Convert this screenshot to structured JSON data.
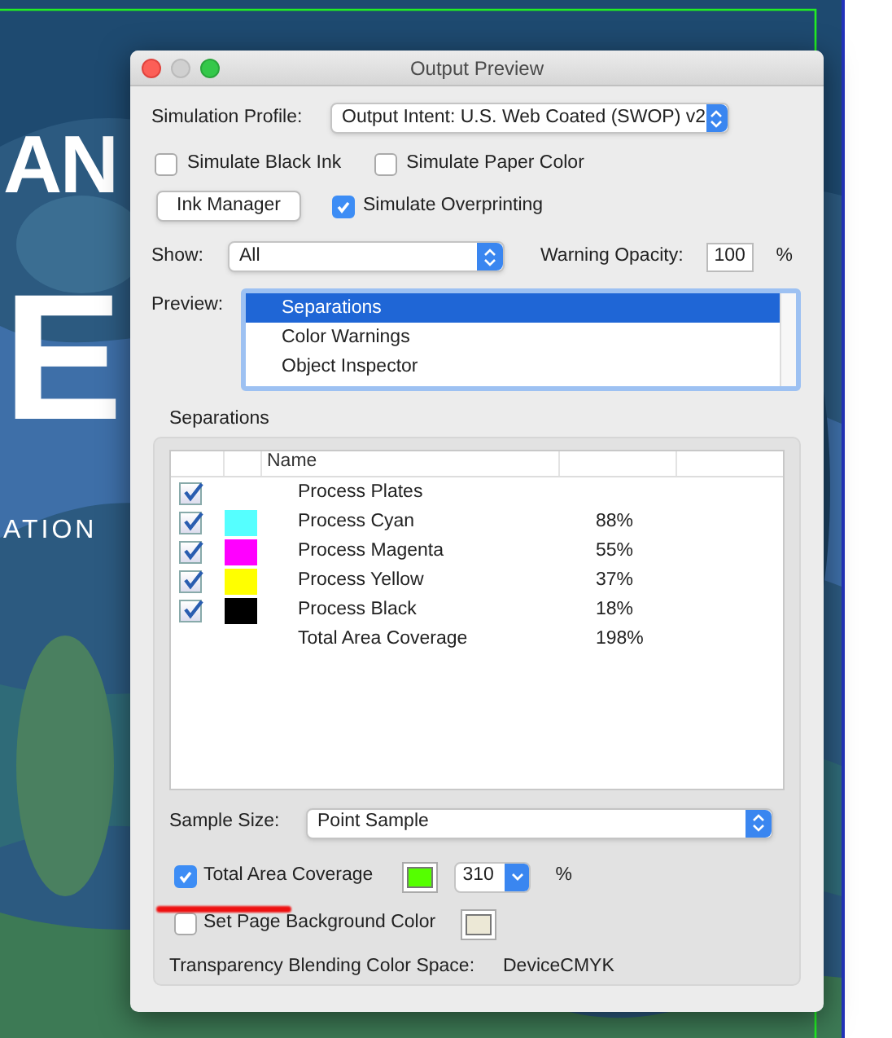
{
  "canvas": {
    "texts": [
      {
        "kind": "big",
        "text": "AN"
      },
      {
        "kind": "huge",
        "text": "E"
      },
      {
        "kind": "small",
        "text": "ATION"
      }
    ]
  },
  "window": {
    "title": "Output Preview"
  },
  "simulation_profile": {
    "label": "Simulation Profile:",
    "value": "Output Intent: U.S. Web Coated (SWOP) v2"
  },
  "options": [
    {
      "label": "Simulate Black Ink",
      "checked": false
    },
    {
      "label": "Simulate Paper Color",
      "checked": false
    }
  ],
  "ink_manager_button": "Ink Manager",
  "simulate_overprinting": {
    "label": "Simulate Overprinting",
    "checked": true
  },
  "show": {
    "label": "Show:",
    "value": "All"
  },
  "warning_opacity": {
    "label": "Warning Opacity:",
    "value": "100",
    "unit": "%"
  },
  "preview": {
    "label": "Preview:",
    "items": [
      {
        "label": "Separations",
        "selected": true
      },
      {
        "label": "Color Warnings",
        "selected": false
      },
      {
        "label": "Object Inspector",
        "selected": false
      }
    ]
  },
  "separations": {
    "title": "Separations",
    "columns": [
      "Name"
    ],
    "rows": [
      {
        "name": "Process Plates",
        "checked": true
      },
      {
        "name": "Process Cyan",
        "checked": true,
        "color": "#55ffff",
        "value": "88%"
      },
      {
        "name": "Process Magenta",
        "checked": true,
        "color": "#ff00ff",
        "value": "55%"
      },
      {
        "name": "Process Yellow",
        "checked": true,
        "color": "#ffff00",
        "value": "37%"
      },
      {
        "name": "Process Black",
        "checked": true,
        "color": "#000000",
        "value": "18%"
      },
      {
        "name": "Total Area Coverage",
        "value": "198%"
      }
    ],
    "sample_size": {
      "label": "Sample Size:",
      "value": "Point Sample"
    },
    "total_area_coverage": {
      "label": "Total Area Coverage",
      "checked": true,
      "color": "#55ff00",
      "value": "310",
      "unit": "%"
    },
    "page_background": {
      "label": "Set Page Background Color",
      "checked": false,
      "color": "#ece8d6"
    },
    "blending": {
      "label": "Transparency Blending Color Space:",
      "value": "DeviceCMYK"
    }
  }
}
